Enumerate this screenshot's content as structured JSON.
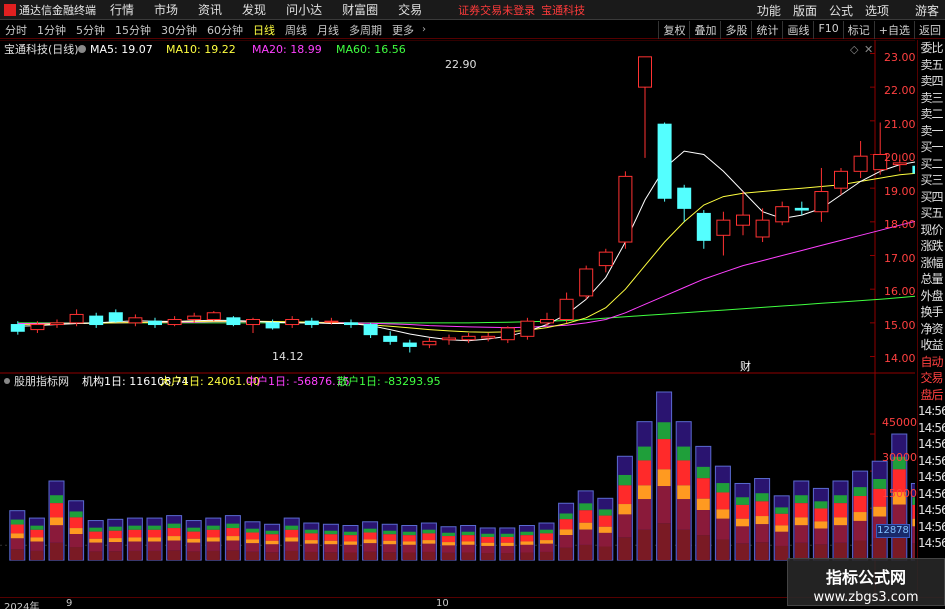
{
  "app": {
    "logo_text": "通达信金融终端",
    "menu": [
      "行情",
      "市场",
      "资讯",
      "发现",
      "问小达",
      "财富圈",
      "交易"
    ],
    "notice": "证券交易未登录",
    "stock_name_top": "宝通科技",
    "right_menu": [
      "功能",
      "版面",
      "公式",
      "选项",
      "游客"
    ]
  },
  "toolbar": {
    "periods": [
      "分时",
      "1分钟",
      "5分钟",
      "15分钟",
      "30分钟",
      "60分钟",
      "日线",
      "周线",
      "月线",
      "多周期",
      "更多"
    ],
    "active_period": "日线",
    "right_buttons": [
      "复权",
      "叠加",
      "多股",
      "统计",
      "画线",
      "F10",
      "标记",
      "+自选",
      "返回"
    ]
  },
  "main_chart": {
    "title": "宝通科技(日线)",
    "ma": [
      {
        "label": "MA5: 19.07",
        "color": "#ffffff"
      },
      {
        "label": "MA10: 19.22",
        "color": "#ffff40"
      },
      {
        "label": "MA20: 18.99",
        "color": "#ff40ff"
      },
      {
        "label": "MA60: 16.56",
        "color": "#40ff40"
      }
    ],
    "high_label": "22.90",
    "low_label": "14.12",
    "marker": "财",
    "y_ticks": [
      "23.00",
      "22.00",
      "21.00",
      "20.00",
      "19.00",
      "18.00",
      "17.00",
      "16.00",
      "15.00",
      "14.00"
    ]
  },
  "sub_chart": {
    "title": "股朋指标网",
    "items": [
      {
        "label": "机构1日: 116108.74",
        "color": "#ffffff"
      },
      {
        "label": "大户1日: 24061.00",
        "color": "#ffff40"
      },
      {
        "label": "中户1日: -56876.15",
        "color": "#ff40ff"
      },
      {
        "label": "散户1日: -83293.95",
        "color": "#40ff40"
      }
    ],
    "y_ticks": [
      "45000",
      "30000",
      "15000",
      "0"
    ],
    "current_value": "12878"
  },
  "side_panel": [
    "委比",
    "卖五",
    "卖四",
    "卖三",
    "卖二",
    "卖一",
    "买一",
    "买二",
    "买三",
    "买四",
    "买五",
    "现价",
    "涨跌",
    "涨幅",
    "总量",
    "外盘",
    "换手",
    "净资",
    "收益",
    "自动",
    "交易",
    "盘后",
    "14:56",
    "14:56",
    "14:56",
    "14:56",
    "14:56",
    "14:56",
    "14:56",
    "14:56",
    "14:56"
  ],
  "x_axis": {
    "year": "2024年",
    "m1": "9",
    "m2": "10"
  },
  "watermark": {
    "line1": "指标公式网",
    "line2": "www.zbgs3.com"
  },
  "chart_data": {
    "type": "candlestick",
    "ylim": [
      13.6,
      23.4
    ],
    "candles": [
      {
        "o": 14.95,
        "c": 14.75,
        "h": 15.05,
        "l": 14.65
      },
      {
        "o": 14.8,
        "c": 14.95,
        "h": 15.05,
        "l": 14.7
      },
      {
        "o": 14.95,
        "c": 15.0,
        "h": 15.1,
        "l": 14.85
      },
      {
        "o": 15.0,
        "c": 15.25,
        "h": 15.4,
        "l": 14.9
      },
      {
        "o": 15.2,
        "c": 14.95,
        "h": 15.3,
        "l": 14.85
      },
      {
        "o": 15.3,
        "c": 15.05,
        "h": 15.4,
        "l": 15.0
      },
      {
        "o": 15.0,
        "c": 15.15,
        "h": 15.25,
        "l": 14.9
      },
      {
        "o": 15.05,
        "c": 14.95,
        "h": 15.15,
        "l": 14.85
      },
      {
        "o": 14.95,
        "c": 15.1,
        "h": 15.2,
        "l": 14.9
      },
      {
        "o": 15.1,
        "c": 15.2,
        "h": 15.3,
        "l": 15.0
      },
      {
        "o": 15.1,
        "c": 15.3,
        "h": 15.35,
        "l": 15.05
      },
      {
        "o": 15.15,
        "c": 14.95,
        "h": 15.2,
        "l": 14.9
      },
      {
        "o": 14.95,
        "c": 15.1,
        "h": 15.15,
        "l": 14.7
      },
      {
        "o": 15.0,
        "c": 14.85,
        "h": 15.1,
        "l": 14.8
      },
      {
        "o": 14.95,
        "c": 15.1,
        "h": 15.2,
        "l": 14.85
      },
      {
        "o": 15.05,
        "c": 14.95,
        "h": 15.15,
        "l": 14.85
      },
      {
        "o": 15.05,
        "c": 15.05,
        "h": 15.15,
        "l": 14.95
      },
      {
        "o": 15.0,
        "c": 14.95,
        "h": 15.1,
        "l": 14.85
      },
      {
        "o": 14.95,
        "c": 14.65,
        "h": 15.0,
        "l": 14.55
      },
      {
        "o": 14.6,
        "c": 14.45,
        "h": 14.75,
        "l": 14.35
      },
      {
        "o": 14.4,
        "c": 14.3,
        "h": 14.5,
        "l": 14.12
      },
      {
        "o": 14.35,
        "c": 14.45,
        "h": 14.55,
        "l": 14.25
      },
      {
        "o": 14.5,
        "c": 14.55,
        "h": 14.65,
        "l": 14.35
      },
      {
        "o": 14.5,
        "c": 14.6,
        "h": 14.7,
        "l": 14.4
      },
      {
        "o": 14.55,
        "c": 14.6,
        "h": 14.7,
        "l": 14.45
      },
      {
        "o": 14.5,
        "c": 14.85,
        "h": 14.9,
        "l": 14.4
      },
      {
        "o": 14.6,
        "c": 15.05,
        "h": 15.15,
        "l": 14.5
      },
      {
        "o": 15.0,
        "c": 15.1,
        "h": 15.3,
        "l": 14.9
      },
      {
        "o": 15.1,
        "c": 15.7,
        "h": 15.9,
        "l": 15.0
      },
      {
        "o": 15.8,
        "c": 16.6,
        "h": 16.7,
        "l": 15.7
      },
      {
        "o": 16.7,
        "c": 17.1,
        "h": 17.2,
        "l": 16.5
      },
      {
        "o": 17.4,
        "c": 19.35,
        "h": 19.5,
        "l": 17.2
      },
      {
        "o": 22.0,
        "c": 22.9,
        "h": 22.9,
        "l": 19.9
      },
      {
        "o": 20.9,
        "c": 18.7,
        "h": 20.95,
        "l": 18.6
      },
      {
        "o": 19.0,
        "c": 18.4,
        "h": 19.1,
        "l": 18.0
      },
      {
        "o": 18.25,
        "c": 17.45,
        "h": 18.35,
        "l": 17.2
      },
      {
        "o": 17.6,
        "c": 18.05,
        "h": 18.3,
        "l": 17.0
      },
      {
        "o": 17.9,
        "c": 18.2,
        "h": 18.9,
        "l": 17.6
      },
      {
        "o": 17.55,
        "c": 18.05,
        "h": 18.4,
        "l": 17.4
      },
      {
        "o": 18.0,
        "c": 18.45,
        "h": 18.6,
        "l": 17.9
      },
      {
        "o": 18.4,
        "c": 18.35,
        "h": 18.6,
        "l": 18.2
      },
      {
        "o": 18.3,
        "c": 18.9,
        "h": 19.6,
        "l": 18.0
      },
      {
        "o": 19.0,
        "c": 19.5,
        "h": 19.6,
        "l": 18.8
      },
      {
        "o": 19.5,
        "c": 19.95,
        "h": 20.4,
        "l": 19.3
      },
      {
        "o": 19.55,
        "c": 20.0,
        "h": 20.95,
        "l": 19.4
      },
      {
        "o": 19.7,
        "c": 19.75,
        "h": 20.0,
        "l": 19.5
      },
      {
        "o": 19.65,
        "c": 19.45,
        "h": 19.8,
        "l": 19.4
      },
      {
        "o": 19.5,
        "c": 19.95,
        "h": 20.1,
        "l": 19.4
      },
      {
        "o": 19.9,
        "c": 20.05,
        "h": 20.2,
        "l": 19.7
      },
      {
        "o": 19.75,
        "c": 20.05,
        "h": 20.1,
        "l": 19.6
      },
      {
        "o": 20.35,
        "c": 19.1,
        "h": 20.4,
        "l": 19.0
      },
      {
        "o": 19.2,
        "c": 18.95,
        "h": 19.4,
        "l": 18.8
      },
      {
        "o": 18.9,
        "c": 19.0,
        "h": 19.3,
        "l": 18.7
      },
      {
        "o": 18.8,
        "c": 18.15,
        "h": 18.9,
        "l": 18.1
      },
      {
        "o": 18.15,
        "c": 18.55,
        "h": 18.7,
        "l": 18.1
      },
      {
        "o": 18.6,
        "c": 19.05,
        "h": 19.2,
        "l": 18.5
      },
      {
        "o": 19.05,
        "c": 19.45,
        "h": 19.9,
        "l": 19.0
      },
      {
        "o": 19.45,
        "c": 19.7,
        "h": 19.8,
        "l": 19.2
      }
    ],
    "ma5": [
      14.9,
      14.92,
      14.95,
      14.98,
      15.0,
      15.03,
      15.06,
      15.05,
      15.04,
      15.06,
      15.08,
      15.07,
      15.05,
      15.02,
      15.0,
      15.0,
      14.98,
      14.98,
      14.92,
      14.8,
      14.67,
      14.57,
      14.5,
      14.47,
      14.52,
      14.6,
      14.75,
      14.95,
      15.25,
      15.7,
      16.35,
      17.4,
      18.65,
      19.6,
      20.1,
      20.0,
      19.5,
      18.9,
      18.3,
      18.1,
      18.2,
      18.4,
      18.8,
      19.2,
      19.5,
      19.7,
      19.8,
      19.85,
      19.9,
      19.85,
      19.6,
      19.4,
      19.3,
      19.05,
      18.95,
      18.95,
      19.1,
      19.07
    ],
    "ma10": [
      14.95,
      14.96,
      14.97,
      14.98,
      14.99,
      15.0,
      15.01,
      15.02,
      15.03,
      15.04,
      15.05,
      15.05,
      15.05,
      15.04,
      15.03,
      15.02,
      15.0,
      14.98,
      14.94,
      14.9,
      14.85,
      14.8,
      14.76,
      14.73,
      14.72,
      14.73,
      14.78,
      14.86,
      14.98,
      15.15,
      15.45,
      16.0,
      16.7,
      17.4,
      18.0,
      18.5,
      18.75,
      18.85,
      18.9,
      18.95,
      19.0,
      19.05,
      19.1,
      19.2,
      19.3,
      19.4,
      19.45,
      19.5,
      19.55,
      19.55,
      19.5,
      19.45,
      19.4,
      19.35,
      19.3,
      19.25,
      19.22,
      19.22
    ],
    "ma20": [
      14.98,
      14.98,
      14.99,
      14.99,
      15.0,
      15.0,
      15.01,
      15.01,
      15.02,
      15.02,
      15.03,
      15.03,
      15.03,
      15.03,
      15.02,
      15.02,
      15.01,
      15.0,
      14.99,
      14.97,
      14.95,
      14.92,
      14.9,
      14.88,
      14.87,
      14.86,
      14.87,
      14.9,
      14.93,
      15.0,
      15.1,
      15.3,
      15.55,
      15.8,
      16.05,
      16.3,
      16.5,
      16.7,
      16.85,
      17.0,
      17.15,
      17.3,
      17.45,
      17.6,
      17.75,
      17.9,
      18.05,
      18.2,
      18.35,
      18.5,
      18.6,
      18.7,
      18.75,
      18.8,
      18.85,
      18.9,
      18.95,
      18.99
    ],
    "ma60": [
      15.0,
      15.0,
      15.0,
      15.0,
      15.0,
      15.0,
      15.0,
      15.0,
      15.0,
      15.0,
      15.0,
      15.0,
      15.0,
      15.0,
      15.0,
      15.0,
      15.0,
      15.0,
      15.0,
      15.0,
      15.0,
      15.0,
      15.0,
      15.0,
      15.01,
      15.02,
      15.03,
      15.05,
      15.07,
      15.1,
      15.14,
      15.18,
      15.22,
      15.26,
      15.3,
      15.34,
      15.38,
      15.42,
      15.46,
      15.5,
      15.54,
      15.58,
      15.62,
      15.66,
      15.7,
      15.75,
      15.8,
      15.85,
      15.9,
      15.95,
      16.0,
      16.05,
      16.12,
      16.2,
      16.28,
      16.36,
      16.46,
      16.56
    ],
    "volume": {
      "ylim": [
        -10000,
        62000
      ],
      "bars": [
        14000,
        11000,
        26000,
        18000,
        10000,
        10500,
        11000,
        11000,
        12000,
        10000,
        11000,
        12000,
        9500,
        8500,
        11000,
        9000,
        8500,
        8000,
        9500,
        8500,
        8000,
        9000,
        7500,
        8000,
        7000,
        7000,
        8000,
        9000,
        17000,
        22000,
        19000,
        36000,
        50000,
        62000,
        50000,
        40000,
        32000,
        25000,
        27000,
        20000,
        26000,
        23000,
        26000,
        30000,
        34000,
        45000,
        25000,
        27000,
        22000,
        21000,
        20000,
        36000,
        32000,
        24000,
        22000,
        20000,
        25000,
        30000
      ]
    }
  }
}
